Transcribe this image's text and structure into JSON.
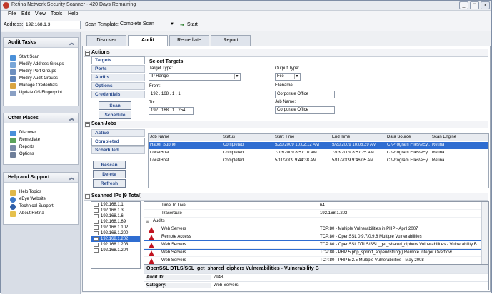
{
  "window": {
    "title": "Retina Network Security Scanner - 420  Days Remaining",
    "min": "_",
    "max": "□",
    "close": "x"
  },
  "menu": [
    "File",
    "Edit",
    "View",
    "Tools",
    "Help"
  ],
  "address": {
    "label": "Address:",
    "value": "192.168.1.3",
    "template_label": "Scan Template:",
    "template_value": "Complete Scan",
    "start_label": "Start"
  },
  "sidebar": {
    "audit_tasks": {
      "title": "Audit Tasks",
      "items": [
        "Start Scan",
        "Modify Address Groups",
        "Modify Port Groups",
        "Modify Audit Groups",
        "Manage Credentials",
        "Update OS Fingerprint"
      ]
    },
    "other_places": {
      "title": "Other Places",
      "items": [
        "Discover",
        "Remediate",
        "Reports",
        "Options"
      ]
    },
    "help": {
      "title": "Help and Support",
      "items": [
        "Help Topics",
        "eEye Website",
        "Technical Support",
        "About Retina"
      ]
    }
  },
  "tabs": [
    "Discover",
    "Audit",
    "Remediate",
    "Report"
  ],
  "actions": {
    "title": "Actions",
    "buttons": [
      "Targets",
      "Ports",
      "Audits",
      "Options",
      "Credentials"
    ],
    "scan": "Scan",
    "schedule": "Schedule",
    "select_targets": "Select Targets",
    "target_type_label": "Target Type:",
    "target_type_value": "IP Range",
    "from_label": "From:",
    "from_value": "192 . 168 . 1 . 1",
    "to_label": "To:",
    "to_value": "192 . 168 . 1 . 254",
    "output_type_label": "Output Type:",
    "output_type_value": "File",
    "filename_label": "Filename:",
    "filename_value": "Corporate Office",
    "jobname_label": "Job Name:",
    "jobname_value": "Corporate Office"
  },
  "scan_jobs": {
    "title": "Scan Jobs",
    "views": [
      "Active",
      "Completed",
      "Scheduled"
    ],
    "buttons": [
      "Rescan",
      "Delete",
      "Refresh"
    ],
    "columns": [
      "Job Name",
      "Status",
      "Start Time",
      "End Time",
      "Data Source",
      "Scan Engine"
    ],
    "rows": [
      [
        "Haber Subnet",
        "Completed",
        "5/20/2009 10:02:12 AM",
        "5/20/2009 10:08:39 AM",
        "C:\\Program Files\\eEy...",
        "Retina"
      ],
      [
        "LocalHost",
        "Completed",
        "7/13/2009 8:57:10 AM",
        "7/13/2009 8:57:25 AM",
        "C:\\Program Files\\eEy...",
        "Retina"
      ],
      [
        "LocalHost",
        "Completed",
        "5/11/2009 9:44:38 AM",
        "5/11/2009 9:46:05 AM",
        "C:\\Program Files\\eEy...",
        "Retina"
      ]
    ]
  },
  "scanned_ips": {
    "title": "Scanned IPs [9 Total]",
    "ips": [
      "192.168.1.1",
      "192.168.1.3",
      "192.168.1.6",
      "192.168.1.69",
      "192.168.1.102",
      "192.168.1.200",
      "192.168.1.202",
      "192.168.1.203",
      "192.168.1.204"
    ],
    "rows": [
      {
        "k": "Time To Live",
        "v": "64"
      },
      {
        "k": "Traceroute",
        "v": "192.168.1.202"
      },
      {
        "k": "Audits",
        "v": ""
      },
      {
        "k": "Web Servers",
        "v": "TCP:80 - Multiple Vulnerabilities in PHP - April 2007"
      },
      {
        "k": "Remote Access",
        "v": "TCP:80 - OpenSSL 0.9.7/0.9.8 Multiple Vulnerabilities"
      },
      {
        "k": "Web Servers",
        "v": "TCP:80 - OpenSSL DTLS/SSL_get_shared_ciphers Vulnerabilities - Vulnerability B"
      },
      {
        "k": "Web Servers",
        "v": "TCP:80 - PHP 5 php_sprintf_appendstring() Remote Integer Overflow"
      },
      {
        "k": "Web Servers",
        "v": "TCP:80 - PHP 5.2.5 Multiple Vulnerabilities - May 2008"
      }
    ]
  },
  "vuln": {
    "title": "OpenSSL DTLS/SSL_get_shared_ciphers Vulnerabilities - Vulnerability B",
    "audit_id_label": "Audit ID:",
    "audit_id": "7948",
    "category_label": "Category:",
    "category": "Web Servers"
  },
  "colors": {
    "accent": "#2f6dd1",
    "vuln": "#c1121f",
    "link": "#2a4b8d"
  }
}
